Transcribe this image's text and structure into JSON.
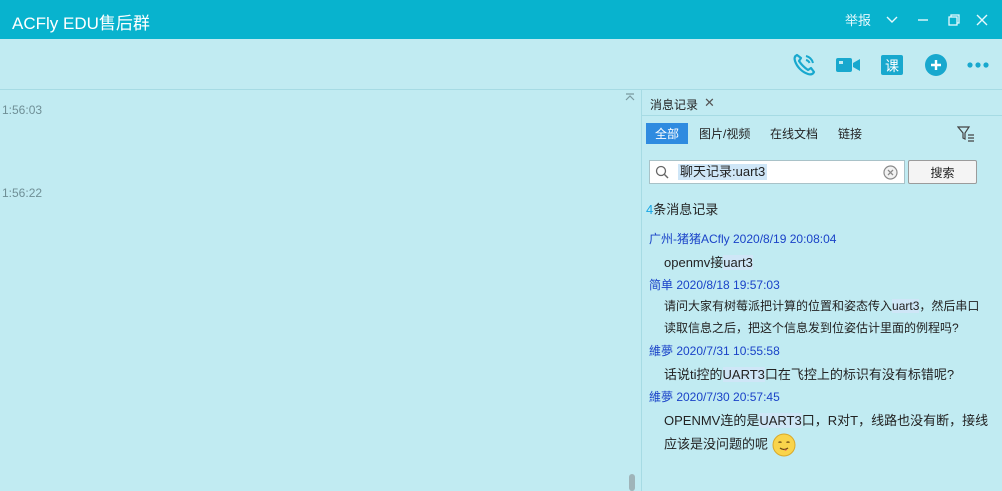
{
  "window": {
    "title": "ACFly EDU售后群",
    "report_label": "举报"
  },
  "chat": {
    "timestamps": [
      "1:56:03",
      "1:56:22"
    ]
  },
  "sidebar": {
    "tab_label": "消息记录",
    "filters": [
      "全部",
      "图片/视频",
      "在线文档",
      "链接"
    ],
    "search_value": "聊天记录:uart3",
    "search_button": "搜索",
    "result_count": "4",
    "result_suffix": "条消息记录",
    "records": [
      {
        "sender": "广州-猪猪ACfly 2020/8/19 20:08:04",
        "line1_before": "openmv接",
        "line1_match": "uart3",
        "line1_after": ""
      },
      {
        "sender": "简单 2020/8/18 19:57:03",
        "line1_before": "请问大家有树莓派把计算的位置和姿态传入",
        "line1_match": "uart3",
        "line1_after": "，然后串口",
        "line2": "读取信息之后，把这个信息发到位姿估计里面的例程吗?"
      },
      {
        "sender": "維夢 2020/7/31 10:55:58",
        "line1_before": "话说ti控的",
        "line1_match": "UART3",
        "line1_after": "口在飞控上的标识有没有标错呢?"
      },
      {
        "sender": "維夢 2020/7/30 20:57:45",
        "line1_before": "OPENMV连的是",
        "line1_match": "UART3",
        "line1_after": "口，R对T，线路也没有断，接线",
        "line2": "应该是没问题的呢"
      }
    ]
  },
  "colors": {
    "titlebar": "#08b3ce",
    "background": "#c1ebf2",
    "accent": "#2f8be0",
    "sender": "#1a43c8",
    "icon": "#18a8ce"
  }
}
